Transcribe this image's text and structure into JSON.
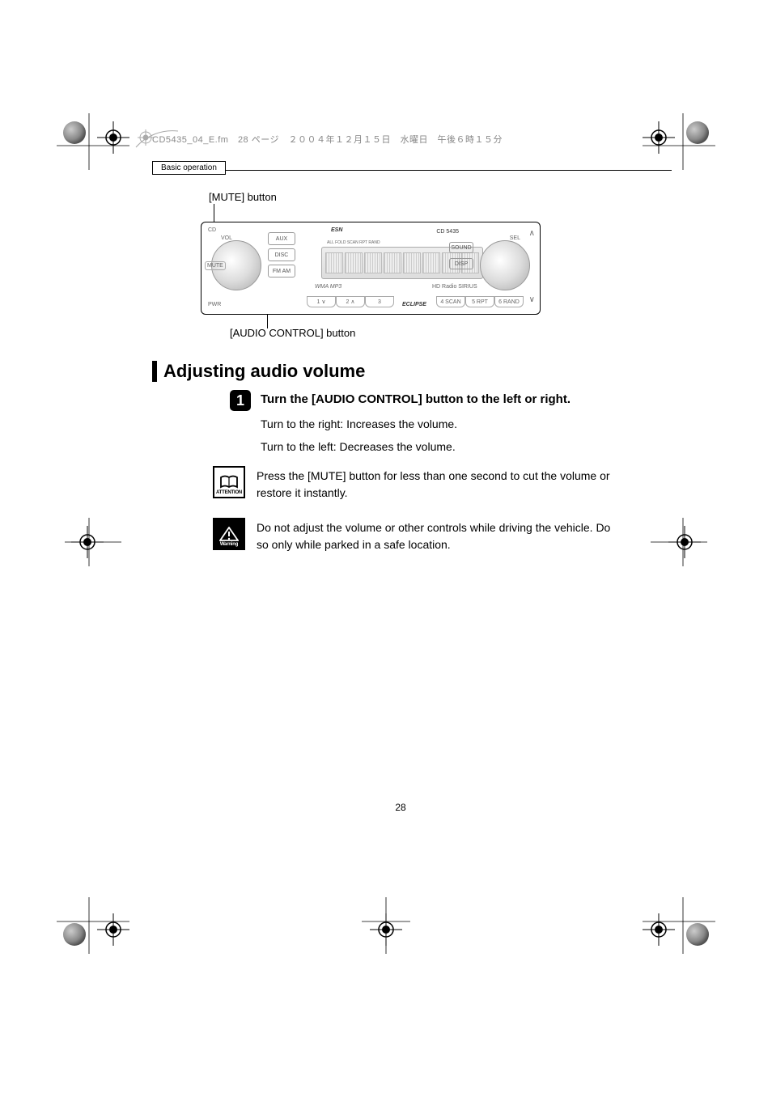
{
  "file_header": "CD5435_04_E.fm　28 ページ　２００４年１２月１５日　水曜日　午後６時１５分",
  "header_tag": "Basic operation",
  "labels": {
    "mute": "[MUTE] button",
    "audio_control": "[AUDIO CONTROL] button"
  },
  "section": {
    "title": "Adjusting audio volume"
  },
  "step": {
    "number": "1",
    "instruction": "Turn the [AUDIO CONTROL] button to the left or right."
  },
  "body": {
    "line1": "Turn to the right: Increases the volume.",
    "line2": "Turn to the left:   Decreases the volume."
  },
  "attention": {
    "label": "ATTENTION",
    "text": "Press the [MUTE] button for less than one second to cut the volume or restore it instantly."
  },
  "warning": {
    "label": "Warning",
    "text": "Do not adjust the volume or other controls while driving the vehicle. Do so only while parked in a safe location."
  },
  "device": {
    "brand": "ESN",
    "model": "CD 5435",
    "eclipse": "ECLIPSE",
    "left_buttons": [
      "AUX",
      "DISC",
      "FM AM"
    ],
    "mute_btn": "MUTE",
    "pwr_btn": "PWR",
    "cd_label": "CD",
    "vol_label": "VOL",
    "sel_label": "SEL",
    "right_buttons": [
      "SOUND",
      "DISP"
    ],
    "bottom_buttons": [
      "1  ∨",
      "2  ∧",
      "3",
      "4 SCAN",
      "5  RPT",
      "6 RAND"
    ],
    "lcd_top": "ALL FOLD SCAN RPT RAND",
    "radio_logos": "HD Radio  SIRIUS",
    "wma": "WMA  MP3"
  },
  "page_number": "28"
}
